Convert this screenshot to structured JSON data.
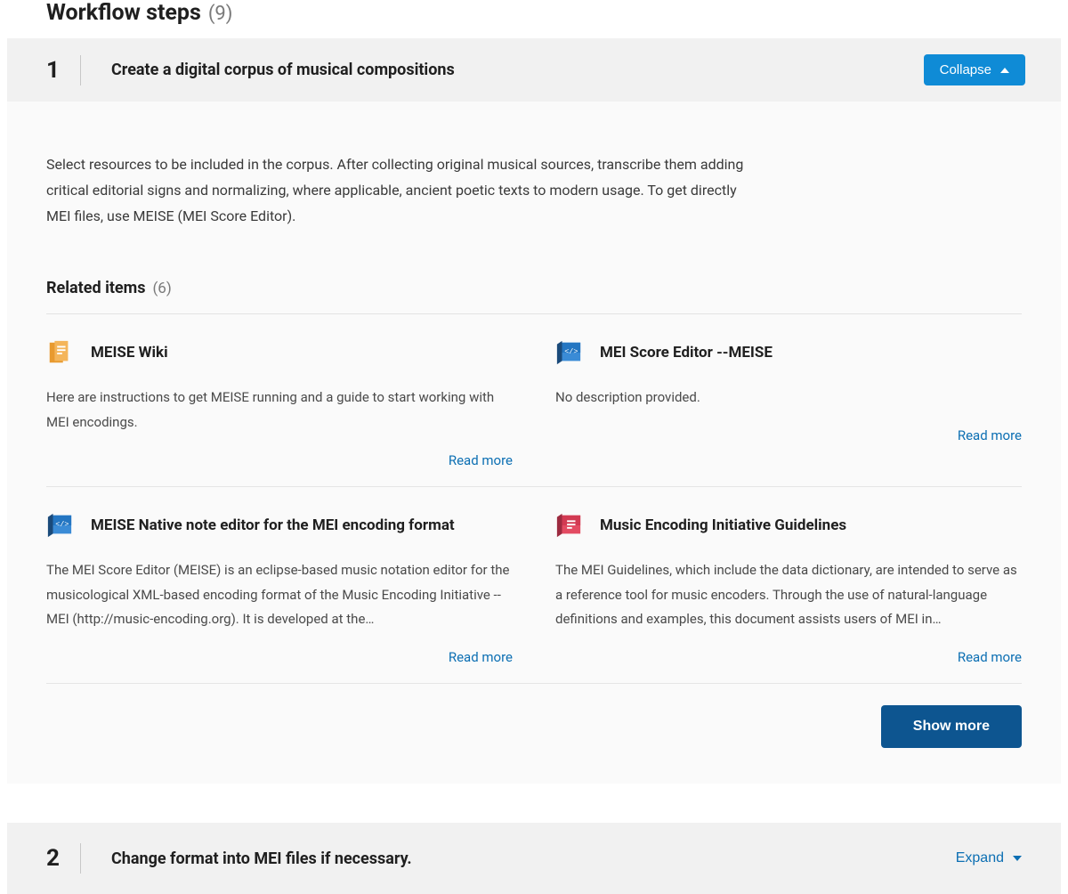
{
  "pageTitle": {
    "text": "Workflow steps",
    "count": "(9)"
  },
  "step1": {
    "number": "1",
    "title": "Create a digital corpus of musical compositions",
    "collapseLabel": "Collapse",
    "description": "Select resources to be included in the corpus. After collecting original musical sources, transcribe them adding critical editorial signs and normalizing, where applicable, ancient poetic texts to modern usage. To get directly MEI files, use MEISE (MEI Score Editor).",
    "related": {
      "title": "Related items",
      "count": "(6)"
    },
    "items": [
      {
        "title": "MEISE Wiki",
        "desc": "Here are instructions to get MEISE running and a guide to start working with MEI encodings.",
        "icon": "orange"
      },
      {
        "title": "MEI Score Editor --MEISE",
        "desc": "No description provided.",
        "icon": "blue"
      },
      {
        "title": "MEISE Native note editor for the MEI encoding format",
        "desc": "The MEI Score Editor (MEISE) is an eclipse-based music notation editor for the musicological XML-based encoding format of the Music Encoding Initiative -- MEI (http://music-encoding.org). It is developed at the…",
        "icon": "blue"
      },
      {
        "title": "Music Encoding Initiative Guidelines",
        "desc": "The MEI Guidelines, which include the data dictionary, are intended to serve as a reference tool for music encoders. Through the use of natural-language definitions and examples, this document assists users of MEI in…",
        "icon": "red"
      }
    ],
    "readMore": "Read more",
    "showMore": "Show more"
  },
  "step2": {
    "number": "2",
    "title": "Change format into MEI files if necessary.",
    "expandLabel": "Expand"
  }
}
